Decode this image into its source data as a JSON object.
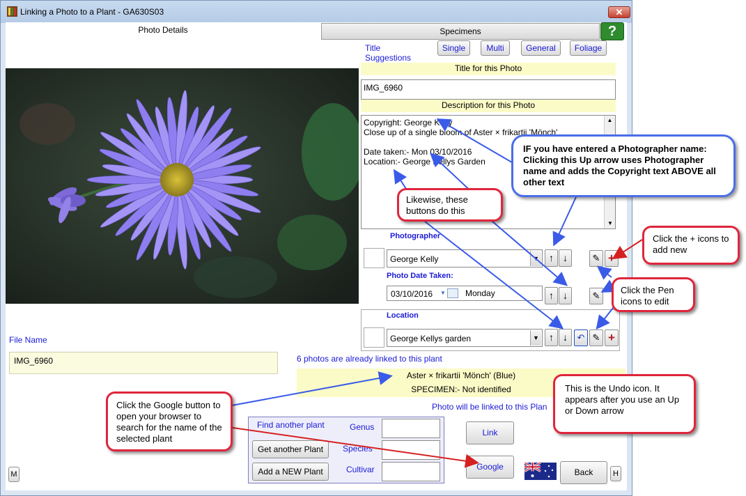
{
  "window": {
    "title": "Linking a Photo to a Plant - GA630S03",
    "close_label": "✕"
  },
  "tabs": {
    "photo_details": "Photo Details",
    "specimens": "Specimens",
    "help": "?"
  },
  "title_suggestions": {
    "label": "Title Suggestions",
    "buttons": [
      "Single",
      "Multi",
      "General",
      "Foliage"
    ]
  },
  "title_photo": {
    "header": "Title for this Photo",
    "value": "IMG_6960"
  },
  "description": {
    "header": "Description for this Photo",
    "lines": [
      "Copyright: George Kelly",
      "Close up of a single bloom of Aster × frikartii 'Mönch'",
      "",
      "Date taken:- Mon 03/10/2016",
      "Location:- George Kellys Garden"
    ]
  },
  "photographer": {
    "label": "Photographer",
    "value": "George Kelly"
  },
  "date_taken": {
    "label": "Photo Date Taken:",
    "date": "03/10/2016",
    "day": "Monday"
  },
  "location": {
    "label": "Location",
    "value": "George Kellys garden"
  },
  "file_name": {
    "label": "File Name",
    "value": "IMG_6960"
  },
  "linked_info": {
    "count_text": "6 photos are already linked to this plant",
    "plant_name": "Aster × frikartii 'Mönch' (Blue)",
    "specimen": "SPECIMEN:- Not identified",
    "will_link": "Photo will be linked to this Plan"
  },
  "plant_search": {
    "find_label": "Find another plant",
    "get_button": "Get another Plant",
    "add_button": "Add a NEW Plant",
    "genus_label": "Genus",
    "species_label": "Species",
    "cultivar_label": "Cultivar"
  },
  "buttons": {
    "link": "Link",
    "google": "Google",
    "back": "Back",
    "m": "M",
    "h": "H"
  },
  "callouts": {
    "photographer_up": "IF you have entered a Photographer name: Clicking this Up arrow uses Photographer name and adds the Copyright text ABOVE all other text",
    "likewise": "Likewise, these buttons do this",
    "plus_icons": "Click the + icons to add new",
    "pen_icons": "Click the Pen icons to edit",
    "undo_icon": "This is the Undo icon. It appears after you use an Up or Down arrow",
    "google": "Click the Google button to open your browser to search for the name of the selected plant"
  },
  "colors": {
    "accent_blue": "#1a1ad6",
    "yellow_bar": "#fbfbc7",
    "callout_red": "#e0253c",
    "callout_blue": "#4a6ee8",
    "arrow_blue": "#3a5be8"
  }
}
